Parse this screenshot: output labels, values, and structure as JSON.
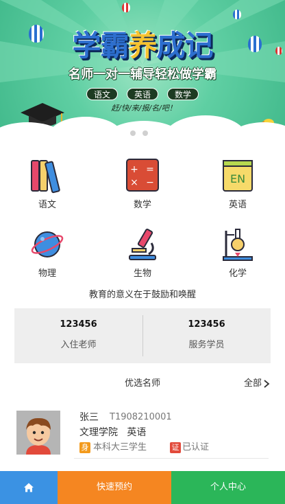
{
  "banner": {
    "title_part1": "学霸",
    "title_part2": "养",
    "title_part3": "成记",
    "subtitle": "名师一对一辅导轻松做学霸",
    "tags": [
      "语文",
      "英语",
      "数学"
    ],
    "slogan": "赶/快/来/报/名/吧！",
    "slide_count": 2,
    "active_slide": 1
  },
  "subjects": [
    {
      "label": "语文",
      "icon": "books-icon"
    },
    {
      "label": "数学",
      "icon": "calculator-icon"
    },
    {
      "label": "英语",
      "icon": "english-notebook-icon"
    },
    {
      "label": "物理",
      "icon": "planet-icon"
    },
    {
      "label": "生物",
      "icon": "microscope-icon"
    },
    {
      "label": "化学",
      "icon": "flask-icon"
    }
  ],
  "motto": "教育的意义在于鼓励和唤醒",
  "stats": [
    {
      "value": "123456",
      "label": "入住老师"
    },
    {
      "value": "123456",
      "label": "服务学员"
    }
  ],
  "featured": {
    "title": "优选名师",
    "more_label": "全部"
  },
  "teachers": [
    {
      "name": "张三",
      "id": "T1908210001",
      "school": "文理学院",
      "subject": "英语",
      "edu_badge": "身",
      "edu_text": "本科大三学生",
      "verify_badge": "证",
      "verify_text": "已认证"
    }
  ],
  "tabbar": {
    "home_icon": "home-icon",
    "booking_label": "快速预约",
    "profile_label": "个人中心"
  },
  "colors": {
    "home_tab": "#3b92e3",
    "booking_tab": "#f58621",
    "profile_tab": "#2bb659",
    "banner_green": "#5fcfa3"
  }
}
